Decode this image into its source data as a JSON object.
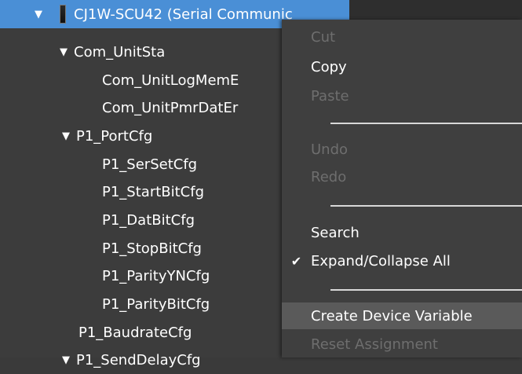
{
  "tree": {
    "rows": [
      {
        "label": "CJ1W-SCU42 (Serial Communic",
        "arrow": "▼",
        "selected": true
      },
      {
        "label": "Com_UnitSta",
        "arrow": "▼"
      },
      {
        "label": "Com_UnitLogMemE"
      },
      {
        "label": "Com_UnitPmrDatEr"
      },
      {
        "label": "P1_PortCfg",
        "arrow": "▼"
      },
      {
        "label": "P1_SerSetCfg"
      },
      {
        "label": "P1_StartBitCfg"
      },
      {
        "label": "P1_DatBitCfg"
      },
      {
        "label": "P1_StopBitCfg"
      },
      {
        "label": "P1_ParityYNCfg"
      },
      {
        "label": "P1_ParityBitCfg"
      },
      {
        "label": "P1_BaudrateCfg"
      },
      {
        "label": "P1_SendDelayCfg",
        "arrow": "▼"
      }
    ]
  },
  "context_menu": {
    "items": [
      {
        "label": "Cut",
        "enabled": false
      },
      {
        "label": "Copy",
        "enabled": true
      },
      {
        "label": "Paste",
        "enabled": false
      },
      {
        "label": "Undo",
        "enabled": false
      },
      {
        "label": "Redo",
        "enabled": false
      },
      {
        "label": "Search",
        "enabled": true
      },
      {
        "label": "Expand/Collapse All",
        "enabled": true,
        "checked": true,
        "check_glyph": "✔"
      },
      {
        "label": "Create Device Variable",
        "enabled": true,
        "hover": true
      },
      {
        "label": "Reset Assignment",
        "enabled": false
      }
    ]
  },
  "colors": {
    "selection": "#4a8fd6",
    "panel": "#3c3c3c",
    "menu": "#3f3f3f",
    "disabled_text": "#6e6e6e"
  }
}
